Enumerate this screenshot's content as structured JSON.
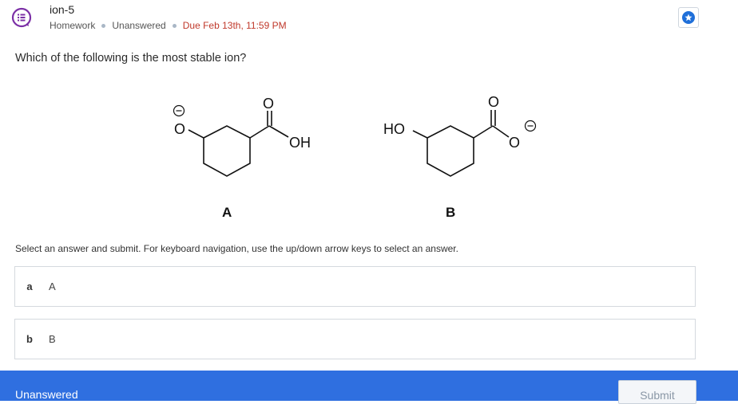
{
  "header": {
    "title": "ion-5",
    "meta_type": "Homework",
    "meta_status": "Unanswered",
    "meta_due": "Due Feb 13th, 11:59 PM",
    "accent_color": "#1f6fd9",
    "due_color": "#c0392b"
  },
  "question": {
    "text": "Which of the following is the most stable ion?"
  },
  "figure": {
    "molecule_a": {
      "label": "A",
      "left_group": "O",
      "right_group": "OH",
      "carbonyl": "O"
    },
    "molecule_b": {
      "label": "B",
      "left_group": "HO",
      "right_group": "O",
      "carbonyl": "O"
    }
  },
  "instructions": "Select an answer and submit. For keyboard navigation, use the up/down arrow keys to select an answer.",
  "choices": [
    {
      "letter": "a",
      "text": "A"
    },
    {
      "letter": "b",
      "text": "B"
    }
  ],
  "footer": {
    "status": "Unanswered",
    "submit_label": "Submit",
    "bar_color": "#2f6fe0"
  }
}
